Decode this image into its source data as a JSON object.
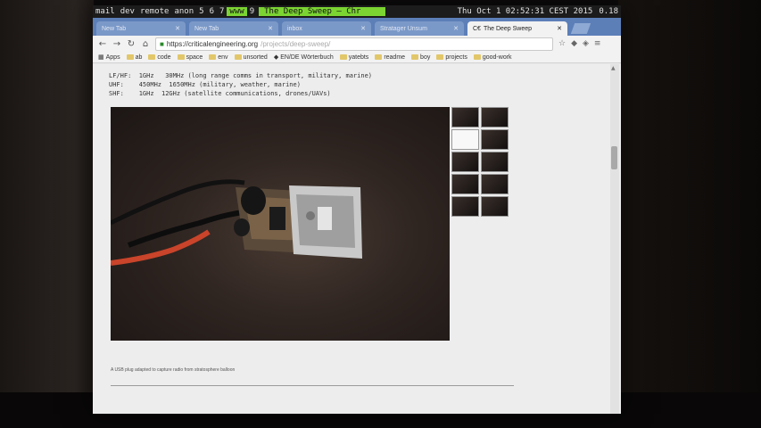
{
  "statusbar": {
    "workspaces": [
      "mail",
      "dev",
      "remote",
      "anon",
      "5",
      "6",
      "7",
      "www",
      "9"
    ],
    "active_workspace": "www",
    "window_title": "The Deep Sweep – Chr",
    "clock": "Thu Oct  1 02:52:31 CEST 2015",
    "extra": "0.18"
  },
  "tabs": [
    {
      "title": "New Tab",
      "active": false
    },
    {
      "title": "New Tab",
      "active": false
    },
    {
      "title": "inbox",
      "active": false
    },
    {
      "title": "Stratager Unsum",
      "active": false
    },
    {
      "title": "The Deep Sweep",
      "active": true
    }
  ],
  "toolbar": {
    "url_host": "https://criticalengineering.org",
    "url_path": "/projects/deep-sweep/"
  },
  "bookmarks": [
    "Apps",
    "ab",
    "code",
    "space",
    "env",
    "unsorted",
    "EN/DE Wörterbuch",
    "yatebts",
    "readme",
    "boy",
    "projects",
    "good-work"
  ],
  "content": {
    "freq_lines": [
      "LF/HF:  1GHz   30MHz (long range comms in transport, military, marine)",
      "UHF:    450MHz  1650MHz (military, weather, marine)",
      "SHF:    1GHz  12GHz (satellite communications, drones/UAVs)"
    ],
    "caption": "A USB plug adapted to capture radio from stratosphere balloon"
  }
}
